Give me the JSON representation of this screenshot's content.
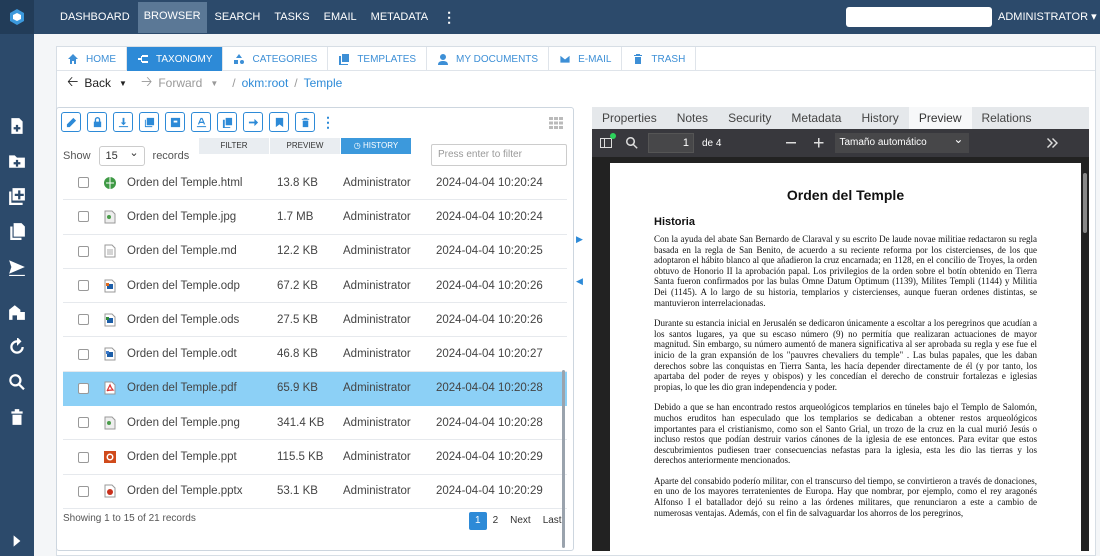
{
  "topbar": {
    "nav": [
      "DASHBOARD",
      "BROWSER",
      "SEARCH",
      "TASKS",
      "EMAIL",
      "METADATA"
    ],
    "active": "BROWSER",
    "user": "ADMINISTRATOR ▾"
  },
  "tabs": [
    "HOME",
    "TAXONOMY",
    "CATEGORIES",
    "TEMPLATES",
    "MY DOCUMENTS",
    "E-MAIL",
    "TRASH"
  ],
  "active_tab": "TAXONOMY",
  "navigation": {
    "back": "Back",
    "forward": "Forward",
    "root": "okm:root",
    "folder": "Temple"
  },
  "list": {
    "subtabs": [
      "FILTER",
      "PREVIEW",
      "HISTORY"
    ],
    "active_subtab": "HISTORY",
    "show_label": "Show",
    "show_value": "15",
    "records_label": "records",
    "filter_placeholder": "Press enter to filter",
    "rows": [
      {
        "name": "Orden del Temple.html",
        "size": "13.8 KB",
        "author": "Administrator",
        "date": "2024-04-04 10:20:24",
        "icon": "html-file-icon"
      },
      {
        "name": "Orden del Temple.jpg",
        "size": "1.7 MB",
        "author": "Administrator",
        "date": "2024-04-04 10:20:24",
        "icon": "image-file-icon"
      },
      {
        "name": "Orden del Temple.md",
        "size": "12.2 KB",
        "author": "Administrator",
        "date": "2024-04-04 10:20:25",
        "icon": "text-file-icon"
      },
      {
        "name": "Orden del Temple.odp",
        "size": "67.2 KB",
        "author": "Administrator",
        "date": "2024-04-04 10:20:26",
        "icon": "odp-file-icon"
      },
      {
        "name": "Orden del Temple.ods",
        "size": "27.5 KB",
        "author": "Administrator",
        "date": "2024-04-04 10:20:26",
        "icon": "ods-file-icon"
      },
      {
        "name": "Orden del Temple.odt",
        "size": "46.8 KB",
        "author": "Administrator",
        "date": "2024-04-04 10:20:27",
        "icon": "odt-file-icon"
      },
      {
        "name": "Orden del Temple.pdf",
        "size": "65.9 KB",
        "author": "Administrator",
        "date": "2024-04-04 10:20:28",
        "icon": "pdf-file-icon",
        "selected": true
      },
      {
        "name": "Orden del Temple.png",
        "size": "341.4 KB",
        "author": "Administrator",
        "date": "2024-04-04 10:20:28",
        "icon": "image-file-icon"
      },
      {
        "name": "Orden del Temple.ppt",
        "size": "115.5 KB",
        "author": "Administrator",
        "date": "2024-04-04 10:20:29",
        "icon": "ppt-file-icon"
      },
      {
        "name": "Orden del Temple.pptx",
        "size": "53.1 KB",
        "author": "Administrator",
        "date": "2024-04-04 10:20:29",
        "icon": "pptx-file-icon"
      }
    ],
    "footer": "Showing 1 to 15 of 21 records",
    "pager": [
      "1",
      "2",
      "Next",
      "Last"
    ]
  },
  "preview": {
    "tabs": [
      "Properties",
      "Notes",
      "Security",
      "Metadata",
      "History",
      "Preview",
      "Relations"
    ],
    "active_tab": "Preview",
    "page_number": "1",
    "page_of": "de 4",
    "zoom": "Tamaño automático",
    "doc": {
      "title": "Orden del Temple",
      "heading": "Historia",
      "paragraphs": [
        "Con la ayuda del abate San Bernardo de Claraval y su escrito De laude novae militiae redactaron su regla basada en la regla de San Benito, de acuerdo a su reciente reforma por los cistercienses, de los que adoptaron el hábito blanco al que añadieron la cruz encarnada; en 1128, en el concilio de Troyes, la orden obtuvo de Honorio II la aprobación papal. Los privilegios de la orden sobre el botín obtenido en Tierra Santa fueron confirmados por las bulas Omne Datum Optimum (1139), Milites Templi (1144) y Militia Dei (1145). A lo largo de su historia, templarios y cistercienses, aunque fueran ordenes distintas, se mantuvieron interrelacionadas.",
        "Durante su estancia inicial en Jerusalén se dedicaron únicamente a escoltar a los peregrinos que acudían a los santos lugares, ya que su escaso número (9) no permitía que realizaran actuaciones de mayor magnitud. Sin embargo, su número aumentó de manera significativa al ser aprobada su regla y ese fue el inicio de la gran expansión de los \"pauvres chevaliers du temple\" . Las bulas papales, que les daban derechos sobre las conquistas en Tierra Santa, les hacía depender directamente de él (y por tanto, los apartaba del poder de reyes y obispos) y les concedían el derecho de construir fortalezas e iglesias propias, lo que les dio gran independencia y poder.",
        "Debido a que se han encontrado restos arqueológicos templarios en túneles bajo el Templo de Salomón, muchos eruditos han especulado que los templarios se dedicaban a obtener restos arqueológicos importantes para el cristianismo, como son el Santo Grial, un trozo de la cruz en la cual murió Jesús o incluso restos que podían destruir varios cánones de la iglesia de ese entonces. Para evitar que estos descubrimientos pudiesen traer consecuencias nefastas para la iglesia, esta les dio las tierras y los derechos anteriormente mencionados.",
        "Aparte del consabido poderío militar, con el transcurso del tiempo, se convirtieron a través de donaciones, en uno de los mayores terratenientes de Europa. Hay que nombrar, por ejemplo, como el rey aragonés Alfonso I el batallador dejó su reino a las órdenes militares, que renunciaron a este a cambio de numerosas ventajas. Además, con el fin de salvaguardar los ahorros de los peregrinos,"
      ]
    }
  },
  "colors": {
    "accent": "#2d8ad7",
    "topbar": "#2c4a6b",
    "selected_row": "#8cd0f6"
  }
}
